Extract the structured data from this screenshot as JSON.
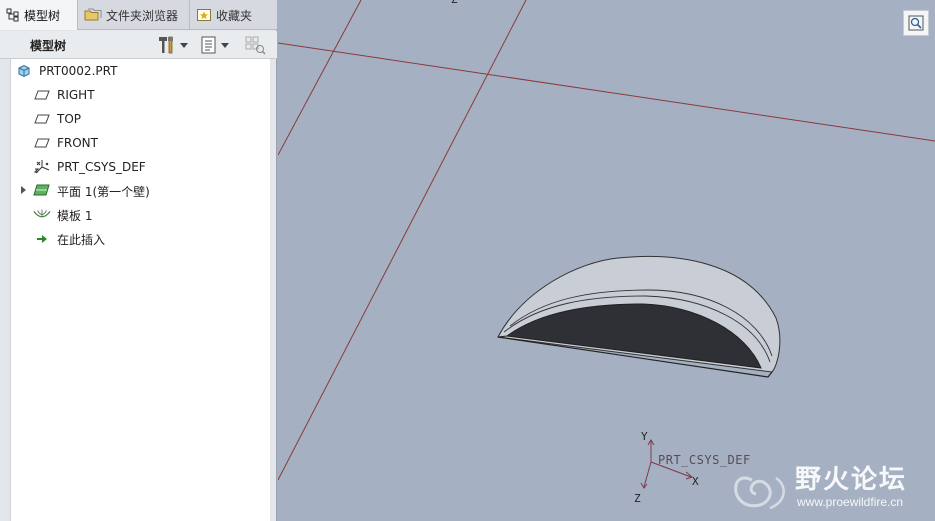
{
  "tabs": [
    {
      "label": "模型树",
      "icon": "tree-icon",
      "active": true
    },
    {
      "label": "文件夹浏览器",
      "icon": "folder-icon",
      "active": false
    },
    {
      "label": "收藏夹",
      "icon": "favorites-icon",
      "active": false
    }
  ],
  "toolbar": {
    "title": "模型树",
    "settings_icon": "settings-tools-icon",
    "show_icon": "show-list-icon",
    "filter_icon": "filter-icon"
  },
  "tree": {
    "items": [
      {
        "label": "PRT0002.PRT",
        "icon": "part-icon"
      },
      {
        "label": "RIGHT",
        "icon": "datum-plane-icon"
      },
      {
        "label": "TOP",
        "icon": "datum-plane-icon"
      },
      {
        "label": "FRONT",
        "icon": "datum-plane-icon"
      },
      {
        "label": "PRT_CSYS_DEF",
        "icon": "csys-icon"
      },
      {
        "label": "平面 1(第一个壁)",
        "icon": "sheetmetal-wall-icon"
      },
      {
        "label": "模板 1",
        "icon": "form-icon"
      },
      {
        "label": "在此插入",
        "icon": "insert-here-icon"
      }
    ]
  },
  "viewport": {
    "csys_label": "PRT_CSYS_DEF",
    "axis_x": "X",
    "axis_y": "Y",
    "axis_z": "Z",
    "top_axis": "Z",
    "zoom_icon": "zoom-fit-icon",
    "background": "#a5b1c2"
  },
  "watermark": {
    "title": "野火论坛",
    "url": "www.proewildfire.cn"
  }
}
